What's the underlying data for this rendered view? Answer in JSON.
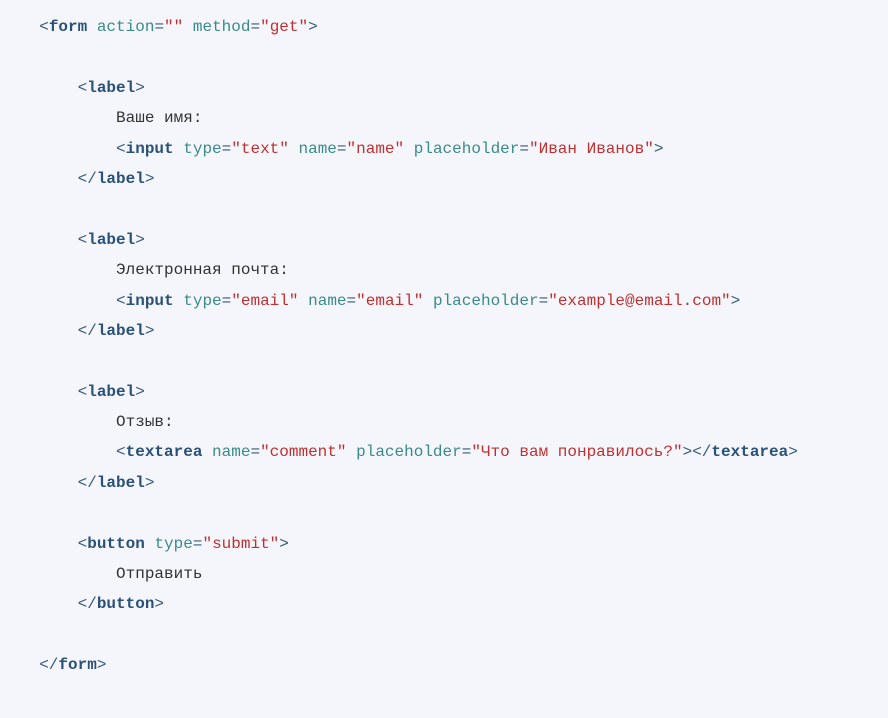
{
  "code": {
    "form": {
      "tag": "form",
      "action": "",
      "method": "get"
    },
    "labelTag": "label",
    "inputTag": "input",
    "textareaTag": "textarea",
    "buttonTag": "button",
    "attrs": {
      "action": "action",
      "method": "method",
      "type": "type",
      "name": "name",
      "placeholder": "placeholder"
    },
    "name": {
      "labelText": "Ваше имя:",
      "type": "text",
      "nameAttr": "name",
      "placeholder": "Иван Иванов"
    },
    "email": {
      "labelText": "Электронная почта:",
      "type": "email",
      "nameAttr": "email",
      "placeholder": "example@email.com"
    },
    "comment": {
      "labelText": "Отзыв:",
      "nameAttr": "comment",
      "placeholder": "Что вам понравилось?"
    },
    "button": {
      "type": "submit",
      "text": "Отправить"
    }
  }
}
